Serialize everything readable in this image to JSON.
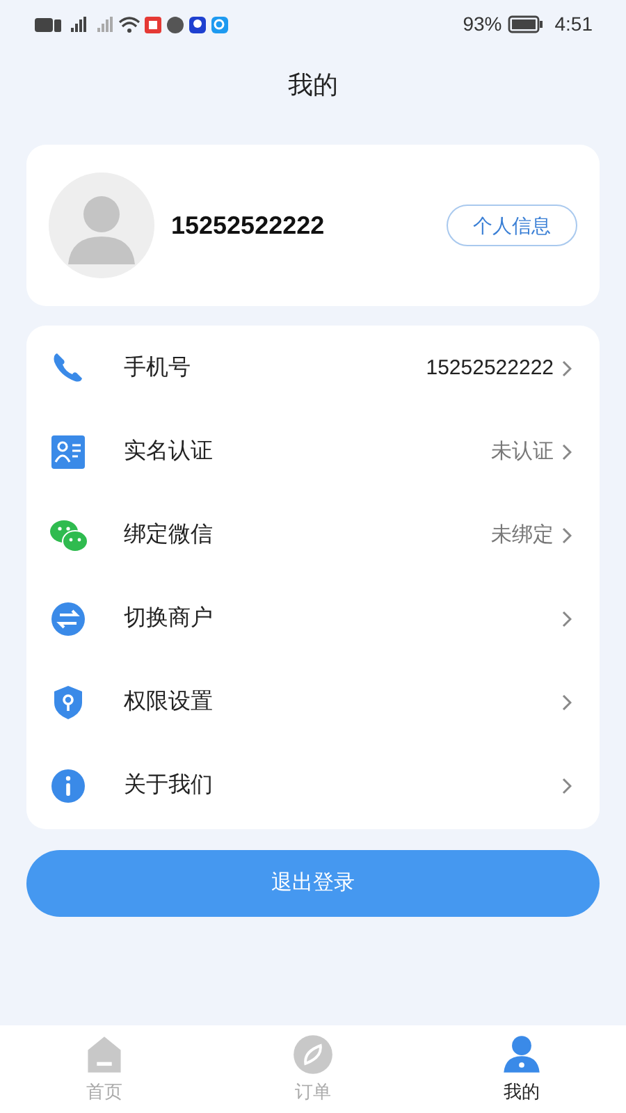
{
  "status_bar": {
    "battery": "93%",
    "time": "4:51"
  },
  "title": "我的",
  "profile": {
    "phone": "15252522222",
    "button": "个人信息"
  },
  "menu": [
    {
      "kind": "phone",
      "label": "手机号",
      "value": "15252522222"
    },
    {
      "kind": "id",
      "label": "实名认证",
      "value": "未认证"
    },
    {
      "kind": "wechat",
      "label": "绑定微信",
      "value": "未绑定"
    },
    {
      "kind": "switch",
      "label": "切换商户"
    },
    {
      "kind": "shield",
      "label": "权限设置"
    },
    {
      "kind": "info",
      "label": "关于我们"
    }
  ],
  "logout": "退出登录",
  "tabs": [
    {
      "kind": "home",
      "label": "首页",
      "selected": false
    },
    {
      "kind": "order",
      "label": "订单",
      "selected": false
    },
    {
      "kind": "me",
      "label": "我的",
      "selected": true
    }
  ]
}
